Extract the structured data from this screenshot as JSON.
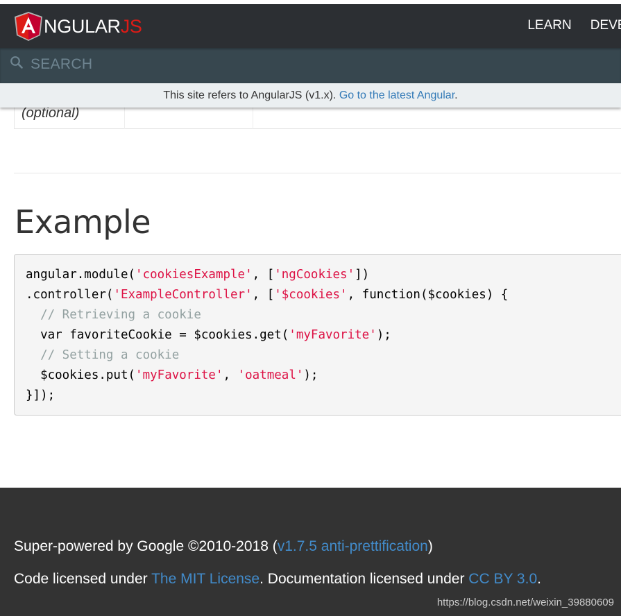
{
  "brand": {
    "logo_letter": "A",
    "wordmark_main": "NGULAR",
    "wordmark_accent": "JS",
    "accent_color": "#dd1b16",
    "navbar_color": "#2c2f33"
  },
  "nav": {
    "items": [
      {
        "label": "LEARN"
      },
      {
        "label": "DEVEL"
      }
    ]
  },
  "search": {
    "placeholder": "SEARCH",
    "icon": "search-icon"
  },
  "banner": {
    "text": "This site refers to AngularJS (v1.x).",
    "link_text": "Go to the latest Angular",
    "suffix": ".",
    "link_color": "#337ab7"
  },
  "table_fragment": {
    "cell_text": "(optional)"
  },
  "example": {
    "heading": "Example",
    "code": {
      "l1_a": "angular.module(",
      "l1_s1": "'cookiesExample'",
      "l1_b": ", [",
      "l1_s2": "'ngCookies'",
      "l1_c": "])",
      "l2_a": ".controller(",
      "l2_s1": "'ExampleController'",
      "l2_b": ", [",
      "l2_s2": "'$cookies'",
      "l2_c": ", function($cookies) {",
      "l3_com": "  // Retrieving a cookie",
      "l4_a": "  var favoriteCookie = $cookies.get(",
      "l4_s1": "'myFavorite'",
      "l4_b": ");",
      "l5_com": "  // Setting a cookie",
      "l6_a": "  $cookies.put(",
      "l6_s1": "'myFavorite'",
      "l6_b": ", ",
      "l6_s2": "'oatmeal'",
      "l6_c": ");",
      "l7": "}]);"
    }
  },
  "footer": {
    "line1_prefix": "Super-powered by Google ©2010-2018 (",
    "line1_link": "v1.7.5 anti-prettification",
    "line1_suffix": ")",
    "line2_prefix": "Code licensed under ",
    "line2_link1": "The MIT License",
    "line2_mid": ". Documentation licensed under ",
    "line2_link2": "CC BY 3.0",
    "line2_suffix": ".",
    "watermark": "https://blog.csdn.net/weixin_39880609"
  }
}
